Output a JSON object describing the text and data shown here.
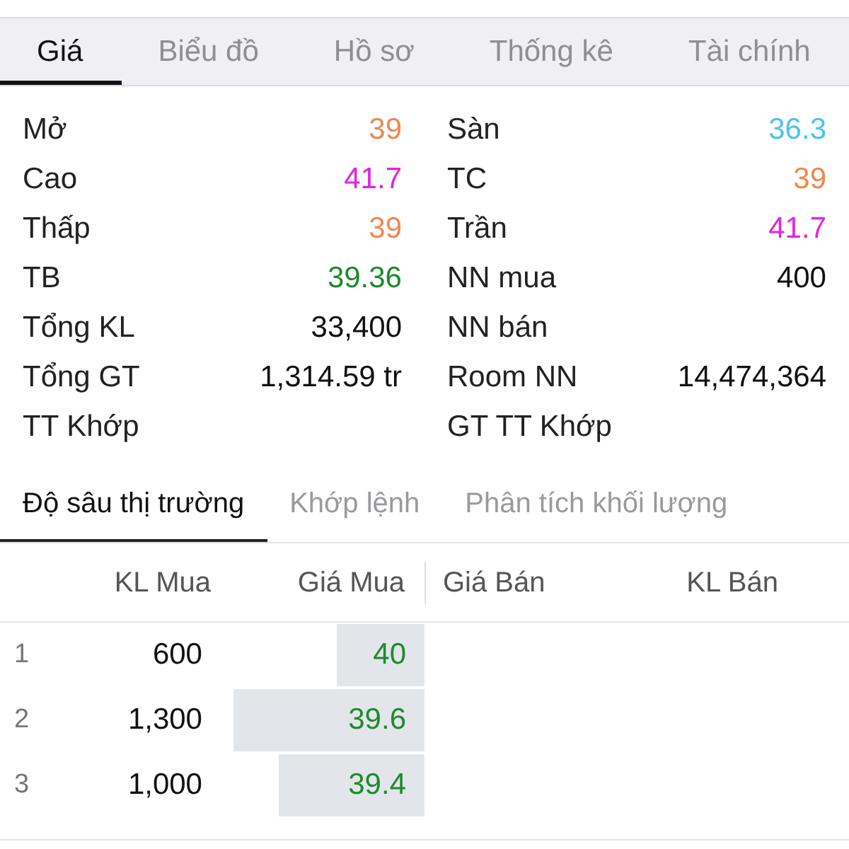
{
  "tabs": [
    {
      "label": "Giá",
      "selected": true
    },
    {
      "label": "Biểu đồ",
      "selected": false
    },
    {
      "label": "Hồ sơ",
      "selected": false
    },
    {
      "label": "Thống kê",
      "selected": false
    },
    {
      "label": "Tài chính",
      "selected": false
    }
  ],
  "summary": {
    "left": [
      {
        "label": "Mở",
        "value": "39",
        "color": "#f0884f"
      },
      {
        "label": "Cao",
        "value": "41.7",
        "color": "#e224e2"
      },
      {
        "label": "Thấp",
        "value": "39",
        "color": "#f0884f"
      },
      {
        "label": "TB",
        "value": "39.36",
        "color": "#1f8a2c"
      },
      {
        "label": "Tổng KL",
        "value": "33,400",
        "color": "#111111"
      },
      {
        "label": "Tổng GT",
        "value": "1,314.59 tr",
        "color": "#111111"
      },
      {
        "label": "TT Khớp"
      }
    ],
    "right": [
      {
        "label": "Sàn",
        "value": "36.3",
        "color": "#4cc3ee"
      },
      {
        "label": "TC",
        "value": "39",
        "color": "#f0884f"
      },
      {
        "label": "Trần",
        "value": "41.7",
        "color": "#e224e2"
      },
      {
        "label": "NN mua",
        "value": "400",
        "color": "#111111"
      },
      {
        "label": "NN bán"
      },
      {
        "label": "Room NN",
        "value": "14,474,364",
        "color": "#111111"
      },
      {
        "label": "GT TT Khớp"
      }
    ]
  },
  "detail_tabs": [
    {
      "label": "Độ sâu thị trường",
      "selected": true
    },
    {
      "label": "Khớp lệnh",
      "selected": false
    },
    {
      "label": "Phân tích khối lượng",
      "selected": false
    }
  ],
  "order_book": {
    "columns": [
      "KL Mua",
      "Giá Mua",
      "Giá Bán",
      "KL Bán"
    ],
    "rows": [
      {
        "index": "1",
        "bid_volume": "600",
        "bid_price": "40"
      },
      {
        "index": "2",
        "bid_volume": "1,300",
        "bid_price": "39.6"
      },
      {
        "index": "3",
        "bid_volume": "1,000",
        "bid_price": "39.4"
      }
    ]
  }
}
